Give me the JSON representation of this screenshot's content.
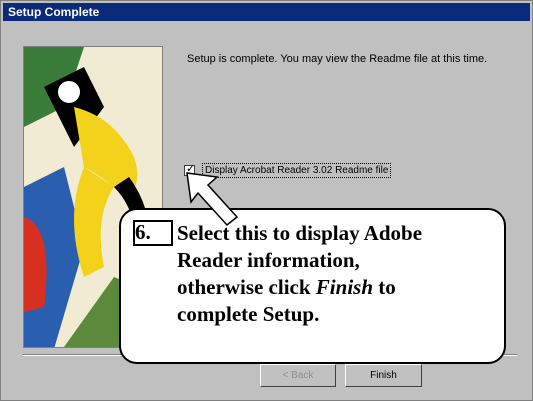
{
  "window": {
    "title": "Setup Complete"
  },
  "message": "Setup is complete.  You may view the Readme file at this time.",
  "checkbox": {
    "label": "Display Acrobat Reader 3.02 Readme file",
    "checked": true
  },
  "buttons": {
    "back_label": "< Back",
    "finish_label": "Finish"
  },
  "callout": {
    "step": "6.",
    "line1": "Select this to display Adobe",
    "line2": "Reader information,",
    "line3_prefix": "otherwise click ",
    "line3_emphasis": "Finish",
    "line3_suffix": " to",
    "line4": "complete Setup."
  },
  "colors": {
    "titlebar": "#0a2a7a",
    "dialog_bg": "#c0c0c0"
  },
  "icons": {
    "pointer": "arrow-up-left-icon"
  }
}
